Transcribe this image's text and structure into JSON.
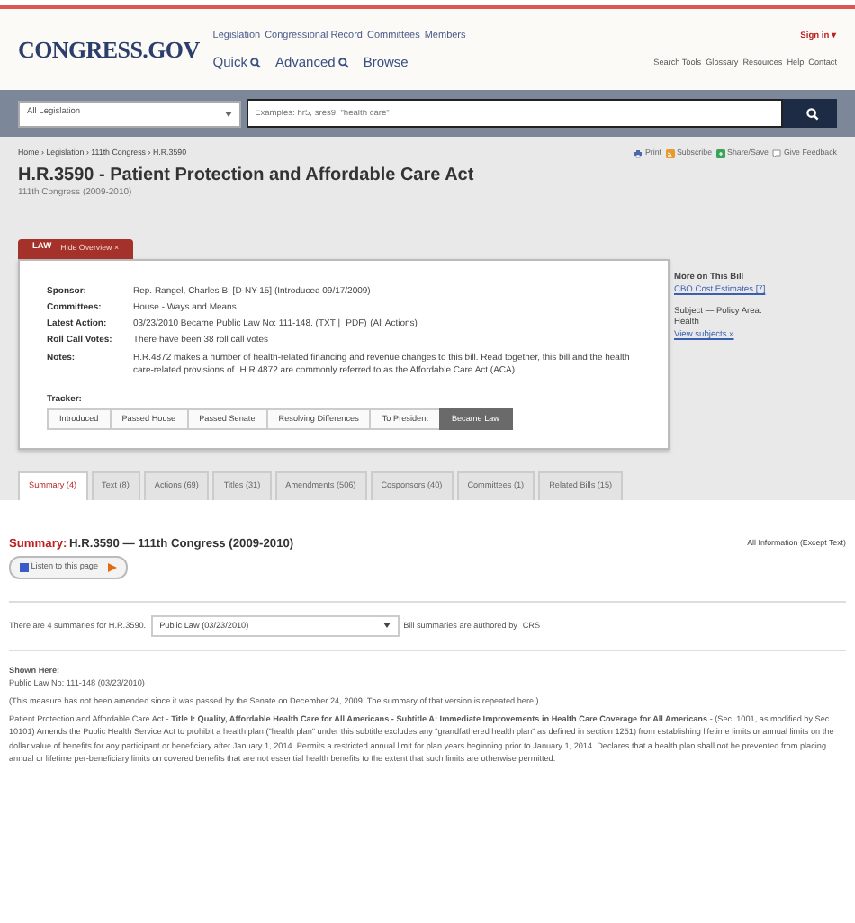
{
  "header": {
    "logo": "CONGRESS.GOV",
    "nav_links": [
      "Legislation",
      "Congressional Record",
      "Committees",
      "Members"
    ],
    "sign_in": "Sign in ▾",
    "search_modes": [
      "Quick",
      "Advanced",
      "Browse"
    ],
    "utility_links": [
      "Search Tools",
      "Glossary",
      "Resources",
      "Help",
      "Contact"
    ]
  },
  "search": {
    "scope": "All Legislation",
    "placeholder": "Examples: hr5, sres9, \"health care\""
  },
  "breadcrumb": {
    "separator": "›",
    "items": [
      "Home",
      "Legislation",
      "111th Congress",
      "H.R.3590"
    ]
  },
  "page_actions": [
    "Print",
    "Subscribe",
    "Share/Save",
    "Give Feedback"
  ],
  "title": "H.R.3590 - Patient Protection and Affordable Care Act",
  "congress": "111th Congress (2009-2010)",
  "overview": {
    "badge": "LAW",
    "hide_label": "Hide Overview ×",
    "fields": [
      {
        "label": "Sponsor:",
        "segments": [
          {
            "kind": "link",
            "text": "Rep. Rangel, Charles B. [D-NY-15]"
          },
          {
            "kind": "text",
            "text": " (Introduced 09/17/2009)"
          }
        ]
      },
      {
        "label": "Committees:",
        "segments": [
          {
            "kind": "text",
            "text": "House - Ways and Means"
          }
        ]
      },
      {
        "label": "Latest Action:",
        "segments": [
          {
            "kind": "text",
            "text": "03/23/2010 Became Public Law No: 111-148. "
          },
          {
            "kind": "link",
            "text": "(TXT"
          },
          {
            "kind": "text",
            "text": " | "
          },
          {
            "kind": "link",
            "text": "PDF)"
          },
          {
            "kind": "link",
            "text": "(All Actions)"
          }
        ]
      },
      {
        "label": "Roll Call Votes:",
        "segments": [
          {
            "kind": "text",
            "text": "There have been "
          },
          {
            "kind": "link",
            "text": "38 roll call votes"
          }
        ]
      },
      {
        "label": "Notes:",
        "segments": [
          {
            "kind": "link",
            "text": "H.R.4872"
          },
          {
            "kind": "text",
            "text": " makes a number of health-related financing and revenue changes to this bill. Read together, this bill and the health care-related provisions of "
          },
          {
            "kind": "link",
            "text": "H.R.4872"
          },
          {
            "kind": "text",
            "text": " are commonly referred to as the Affordable Care Act (ACA)."
          }
        ]
      }
    ],
    "tracker_label": "Tracker:",
    "tracker": [
      {
        "label": "Introduced",
        "selected": false
      },
      {
        "label": "Passed House",
        "selected": false
      },
      {
        "label": "Passed Senate",
        "selected": false
      },
      {
        "label": "Resolving Differences",
        "selected": false
      },
      {
        "label": "To President",
        "selected": false
      },
      {
        "label": "Became Law",
        "selected": true
      }
    ]
  },
  "sidebar": {
    "heading": "More on This Bill",
    "cbo_link": "CBO Cost Estimates [7]",
    "subject": "Subject — Policy Area:",
    "policy_area": "Health",
    "subjects_link": "View subjects »"
  },
  "tabs": [
    {
      "label": "Summary (4)",
      "selected": true
    },
    {
      "label": "Text (8)",
      "selected": false
    },
    {
      "label": "Actions (69)",
      "selected": false
    },
    {
      "label": "Titles (31)",
      "selected": false
    },
    {
      "label": "Amendments (506)",
      "selected": false
    },
    {
      "label": "Cosponsors (40)",
      "selected": false
    },
    {
      "label": "Committees (1)",
      "selected": false
    },
    {
      "label": "Related Bills (15)",
      "selected": false
    }
  ],
  "summary": {
    "heading_label": "Summary:",
    "heading": "H.R.3590 — 111th Congress (2009-2010)",
    "all_info_link": "All Information",
    "all_info_note": "(Except Text)",
    "listen": "Listen to this page",
    "count_text": "There are 4 summaries for H.R.3590.",
    "version": "Public Law (03/23/2010)",
    "authored_link": "Bill summaries",
    "authored_text": " are authored by ",
    "crs_link": "CRS",
    "shown_here": "Shown Here:",
    "shown_value": "Public Law No: 111-148 (03/23/2010)",
    "note": "(This measure has not been amended since it was passed by the Senate on December 24, 2009. The summary of that version is repeated here.)",
    "body": "Patient Protection and Affordable Care Act - **Title I: Quality, Affordable Health Care for All Americans - Subtitle A: Immediate Improvements in Health Care Coverage for All Americans** - (Sec. 1001, as modified by Sec. 10101) Amends the Public Health Service Act to prohibit a health plan (\"health plan\" under this subtitle excludes any \"grandfathered health plan\" as defined in section 1251) from establishing lifetime limits or annual limits on the dollar value of benefits for any participant or beneficiary after January 1, 2014. Permits a restricted annual limit for plan years beginning prior to January 1, 2014. Declares that a health plan shall not be prevented from placing annual or lifetime per-beneficiary limits on covered benefits that are not essential health benefits to the extent that such limits are otherwise permitted."
  }
}
